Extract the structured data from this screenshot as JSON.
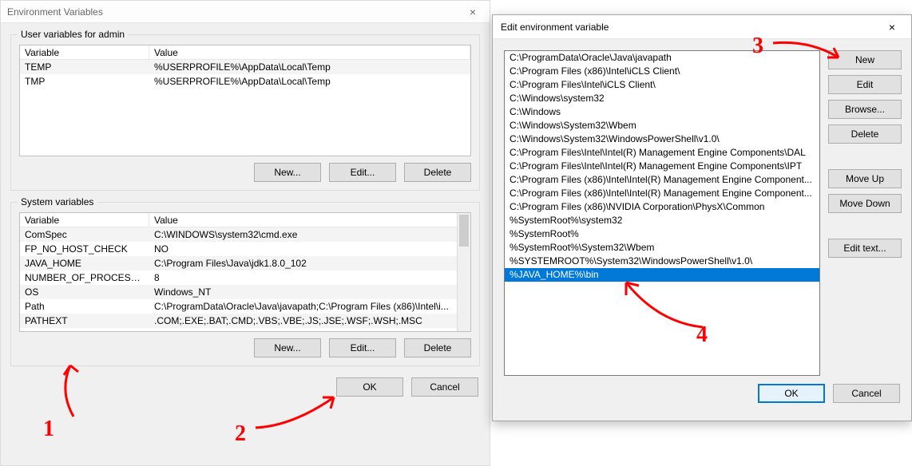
{
  "env_dialog": {
    "title": "Environment Variables",
    "user_group_label": "User variables for admin",
    "system_group_label": "System variables",
    "col_variable": "Variable",
    "col_value": "Value",
    "user_vars": [
      {
        "name": "TEMP",
        "value": "%USERPROFILE%\\AppData\\Local\\Temp"
      },
      {
        "name": "TMP",
        "value": "%USERPROFILE%\\AppData\\Local\\Temp"
      }
    ],
    "system_vars": [
      {
        "name": "ComSpec",
        "value": "C:\\WINDOWS\\system32\\cmd.exe"
      },
      {
        "name": "FP_NO_HOST_CHECK",
        "value": "NO"
      },
      {
        "name": "JAVA_HOME",
        "value": "C:\\Program Files\\Java\\jdk1.8.0_102"
      },
      {
        "name": "NUMBER_OF_PROCESSORS",
        "value": "8"
      },
      {
        "name": "OS",
        "value": "Windows_NT"
      },
      {
        "name": "Path",
        "value": "C:\\ProgramData\\Oracle\\Java\\javapath;C:\\Program Files (x86)\\Intel\\i..."
      },
      {
        "name": "PATHEXT",
        "value": ".COM;.EXE;.BAT;.CMD;.VBS;.VBE;.JS;.JSE;.WSF;.WSH;.MSC"
      }
    ],
    "buttons": {
      "new": "New...",
      "edit": "Edit...",
      "delete": "Delete",
      "ok": "OK",
      "cancel": "Cancel"
    }
  },
  "edit_dialog": {
    "title": "Edit environment variable",
    "paths": [
      "C:\\ProgramData\\Oracle\\Java\\javapath",
      "C:\\Program Files (x86)\\Intel\\iCLS Client\\",
      "C:\\Program Files\\Intel\\iCLS Client\\",
      "C:\\Windows\\system32",
      "C:\\Windows",
      "C:\\Windows\\System32\\Wbem",
      "C:\\Windows\\System32\\WindowsPowerShell\\v1.0\\",
      "C:\\Program Files\\Intel\\Intel(R) Management Engine Components\\DAL",
      "C:\\Program Files\\Intel\\Intel(R) Management Engine Components\\IPT",
      "C:\\Program Files (x86)\\Intel\\Intel(R) Management Engine Component...",
      "C:\\Program Files (x86)\\Intel\\Intel(R) Management Engine Component...",
      "C:\\Program Files (x86)\\NVIDIA Corporation\\PhysX\\Common",
      "%SystemRoot%\\system32",
      "%SystemRoot%",
      "%SystemRoot%\\System32\\Wbem",
      "%SYSTEMROOT%\\System32\\WindowsPowerShell\\v1.0\\",
      "%JAVA_HOME%\\bin"
    ],
    "selected_index": 16,
    "buttons": {
      "new": "New",
      "edit": "Edit",
      "browse": "Browse...",
      "delete": "Delete",
      "move_up": "Move Up",
      "move_down": "Move Down",
      "edit_text": "Edit text...",
      "ok": "OK",
      "cancel": "Cancel"
    }
  },
  "annotations": {
    "n1": "1",
    "n2": "2",
    "n3": "3",
    "n4": "4"
  }
}
